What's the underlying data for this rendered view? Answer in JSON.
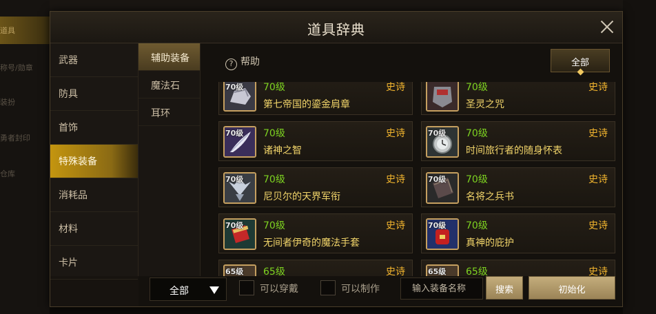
{
  "background": {
    "left_items": [
      "道具",
      "称号/勋章",
      "装扮",
      "勇者封印",
      "仓库"
    ],
    "left_active_index": 0
  },
  "dialog": {
    "title": "道具辞典",
    "close_icon": "close-icon"
  },
  "categories": [
    {
      "label": "武器",
      "active": false
    },
    {
      "label": "防具",
      "active": false
    },
    {
      "label": "首饰",
      "active": false
    },
    {
      "label": "特殊装备",
      "active": true
    },
    {
      "label": "消耗品",
      "active": false
    },
    {
      "label": "材料",
      "active": false
    },
    {
      "label": "卡片",
      "active": false
    }
  ],
  "subcategories": [
    {
      "label": "辅助装备",
      "active": true
    },
    {
      "label": "魔法石",
      "active": false
    },
    {
      "label": "耳环",
      "active": false
    }
  ],
  "toolbar": {
    "help_label": "帮助",
    "help_icon": "question-circle-icon",
    "filter_tab": "全部"
  },
  "items": [
    {
      "thumb_level": "70级",
      "level": "70级",
      "grade": "史诗",
      "name": "第七帝国的鎏金肩章",
      "icon": "gilded-epaulette-icon"
    },
    {
      "thumb_level": "",
      "level": "70级",
      "grade": "史诗",
      "name": "圣灵之咒",
      "icon": "holy-spirit-curse-icon"
    },
    {
      "thumb_level": "70级",
      "level": "70级",
      "grade": "史诗",
      "name": "诸神之智",
      "icon": "feather-icon"
    },
    {
      "thumb_level": "70级",
      "level": "70级",
      "grade": "史诗",
      "name": "时间旅行者的随身怀表",
      "icon": "pocket-watch-icon"
    },
    {
      "thumb_level": "70级",
      "level": "70级",
      "grade": "史诗",
      "name": "尼贝尔的天界军衔",
      "icon": "celestial-insignia-icon"
    },
    {
      "thumb_level": "70级",
      "level": "70级",
      "grade": "史诗",
      "name": "名将之兵书",
      "icon": "war-book-icon"
    },
    {
      "thumb_level": "70级",
      "level": "70级",
      "grade": "史诗",
      "name": "无间者伊奇的魔法手套",
      "icon": "magic-glove-icon"
    },
    {
      "thumb_level": "70级",
      "level": "70级",
      "grade": "史诗",
      "name": "真神的庇护",
      "icon": "red-amulet-icon"
    },
    {
      "thumb_level": "65级",
      "level": "65级",
      "grade": "史诗",
      "name": "",
      "icon": "item-icon"
    },
    {
      "thumb_level": "65级",
      "level": "65级",
      "grade": "史诗",
      "name": "",
      "icon": "item-icon"
    }
  ],
  "bottom": {
    "dropdown_value": "全部",
    "check_wearable": "可以穿戴",
    "check_craftable": "可以制作",
    "search_placeholder": "输入装备名称",
    "search_button": "搜索",
    "reset_button": "初始化"
  },
  "colors": {
    "level_green": "#7ed321",
    "grade_orange": "#f4b62e",
    "name_yellow": "#f2d56a",
    "active_gold": "#c4950f"
  }
}
